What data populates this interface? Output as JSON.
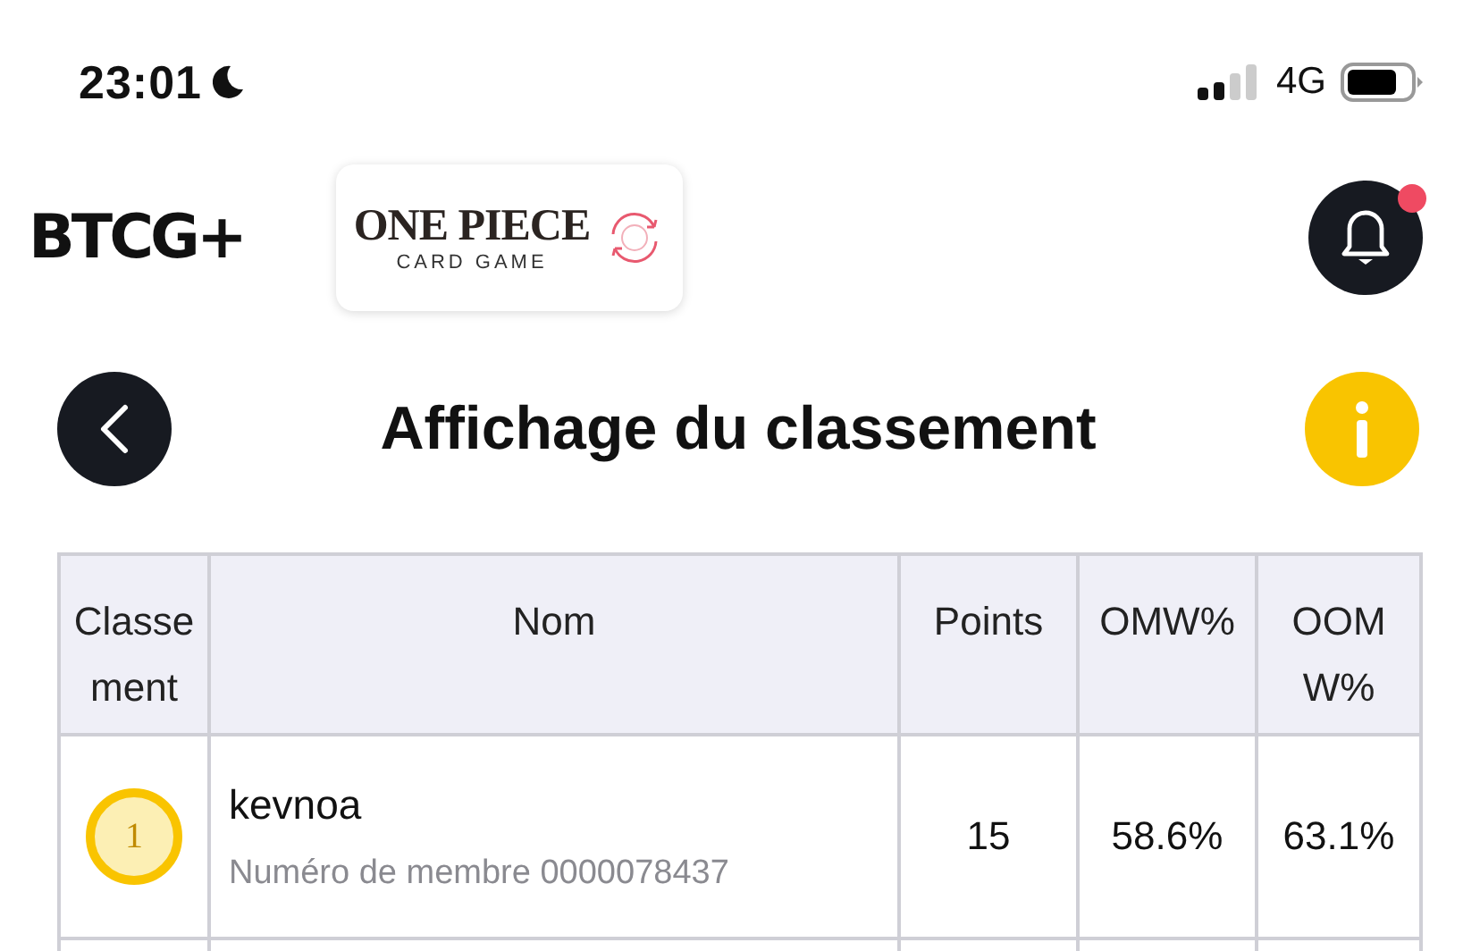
{
  "status_bar": {
    "time": "23:01",
    "network": "4G"
  },
  "header": {
    "brand_logo": "BTCG+",
    "game_logo": {
      "title": "ONE PIECE",
      "subtitle": "CARD GAME"
    },
    "notifications": {
      "unread": true
    }
  },
  "page": {
    "title": "Affichage du classement"
  },
  "table": {
    "columns": [
      "Classement",
      "Nom",
      "Points",
      "OMW%",
      "OOMW%"
    ],
    "rows": [
      {
        "rank": "1",
        "name": "kevnoa",
        "member_number": "Numéro de membre 0000078437",
        "points": "15",
        "omw": "58.6%",
        "oomw": "63.1%"
      }
    ]
  }
}
